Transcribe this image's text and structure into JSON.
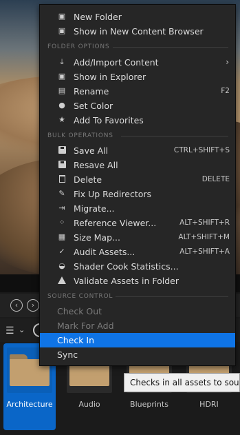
{
  "menu": {
    "top_items": [
      {
        "label": "New Folder",
        "icon": "folder-plus-icon"
      },
      {
        "label": "Show in New Content Browser",
        "icon": "folder-search-icon"
      }
    ],
    "folder_options_header": "FOLDER OPTIONS",
    "folder_options": [
      {
        "label": "Add/Import Content",
        "icon": "import-icon",
        "submenu_arrow": "›"
      },
      {
        "label": "Show in Explorer",
        "icon": "folder-search-icon"
      },
      {
        "label": "Rename",
        "icon": "rename-icon",
        "shortcut": "F2"
      },
      {
        "label": "Set Color",
        "icon": "palette-icon"
      },
      {
        "label": "Add To Favorites",
        "icon": "star-icon"
      }
    ],
    "bulk_header": "BULK OPERATIONS",
    "bulk_operations": [
      {
        "label": "Save All",
        "icon": "save-icon",
        "shortcut": "CTRL+SHIFT+S"
      },
      {
        "label": "Resave All",
        "icon": "save-icon"
      },
      {
        "label": "Delete",
        "icon": "trash-icon",
        "shortcut": "DELETE"
      },
      {
        "label": "Fix Up Redirectors",
        "icon": "wrench-icon"
      },
      {
        "label": "Migrate...",
        "icon": "migrate-icon"
      },
      {
        "label": "Reference Viewer...",
        "icon": "reference-viewer-icon",
        "shortcut": "ALT+SHIFT+R"
      },
      {
        "label": "Size Map...",
        "icon": "size-map-icon",
        "shortcut": "ALT+SHIFT+M"
      },
      {
        "label": "Audit Assets...",
        "icon": "audit-icon",
        "shortcut": "ALT+SHIFT+A"
      },
      {
        "label": "Shader Cook Statistics...",
        "icon": "shader-icon"
      },
      {
        "label": "Validate Assets in Folder",
        "icon": "flask-icon"
      }
    ],
    "source_control_header": "SOURCE CONTROL",
    "source_control": [
      {
        "label": "Check Out",
        "disabled": true
      },
      {
        "label": "Mark For Add",
        "disabled": true
      },
      {
        "label": "Check In",
        "highlighted": true
      },
      {
        "label": "Sync"
      }
    ]
  },
  "tooltip": "Checks in all assets to source control",
  "assets": [
    {
      "label": "Architecture",
      "selected": true
    },
    {
      "label": "Audio"
    },
    {
      "label": "Blueprints"
    },
    {
      "label": "HDRI"
    }
  ],
  "colors": {
    "highlight": "#0f74e6",
    "selected_tile": "#0a66c8",
    "menu_bg": "#262626",
    "folder": "#c29f6f"
  }
}
